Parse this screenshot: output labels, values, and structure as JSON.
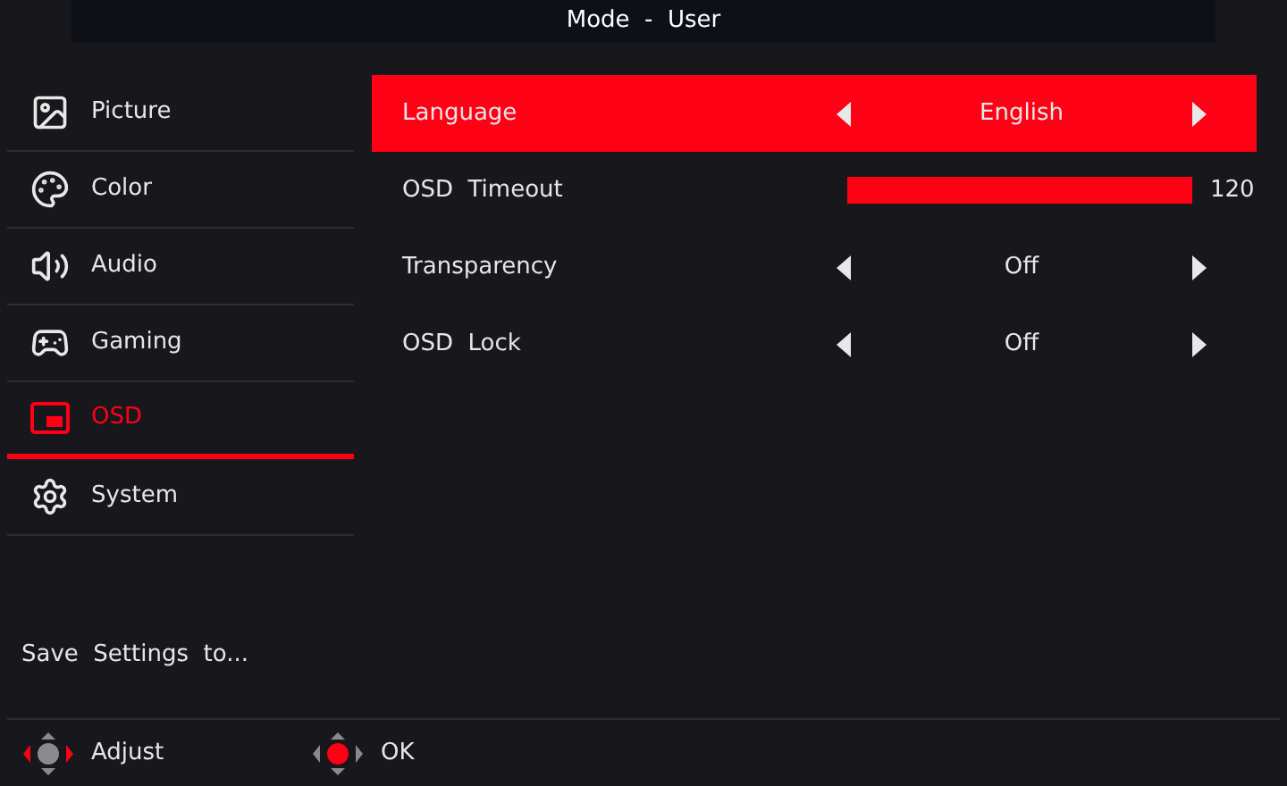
{
  "title": "Mode  -  User",
  "sidebar": {
    "items": [
      {
        "label": "Picture",
        "kind": "picture",
        "selected": false
      },
      {
        "label": "Color",
        "kind": "color",
        "selected": false
      },
      {
        "label": "Audio",
        "kind": "audio",
        "selected": false
      },
      {
        "label": "Gaming",
        "kind": "gaming",
        "selected": false
      },
      {
        "label": "OSD",
        "kind": "osd",
        "selected": true
      },
      {
        "label": "System",
        "kind": "system",
        "selected": false
      }
    ],
    "footer": "Save  Settings  to..."
  },
  "settings": [
    {
      "label": "Language",
      "kind": "selector",
      "value": "English",
      "selected": true
    },
    {
      "label": "OSD  Timeout",
      "kind": "slider",
      "level": 1,
      "reading": "120",
      "selected": false
    },
    {
      "label": "Transparency",
      "kind": "selector",
      "value": "Off",
      "selected": false
    },
    {
      "label": "OSD  Lock",
      "kind": "selector",
      "value": "Off",
      "selected": false
    }
  ],
  "hints": [
    {
      "label": "Adjust",
      "kind": "adjust"
    },
    {
      "label": "OK",
      "kind": "ok"
    }
  ]
}
